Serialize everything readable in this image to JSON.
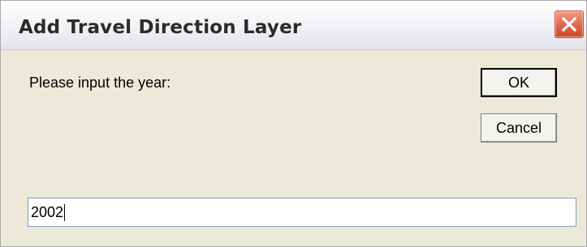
{
  "window": {
    "title": "Add Travel Direction Layer"
  },
  "dialog": {
    "prompt": "Please input the year:",
    "ok_label": "OK",
    "cancel_label": "Cancel",
    "input_value": "2002"
  },
  "icons": {
    "close": "close-icon"
  },
  "colors": {
    "close_button": "#e06b4e",
    "dialog_background": "#ece9d8",
    "input_border": "#7f9db9"
  }
}
